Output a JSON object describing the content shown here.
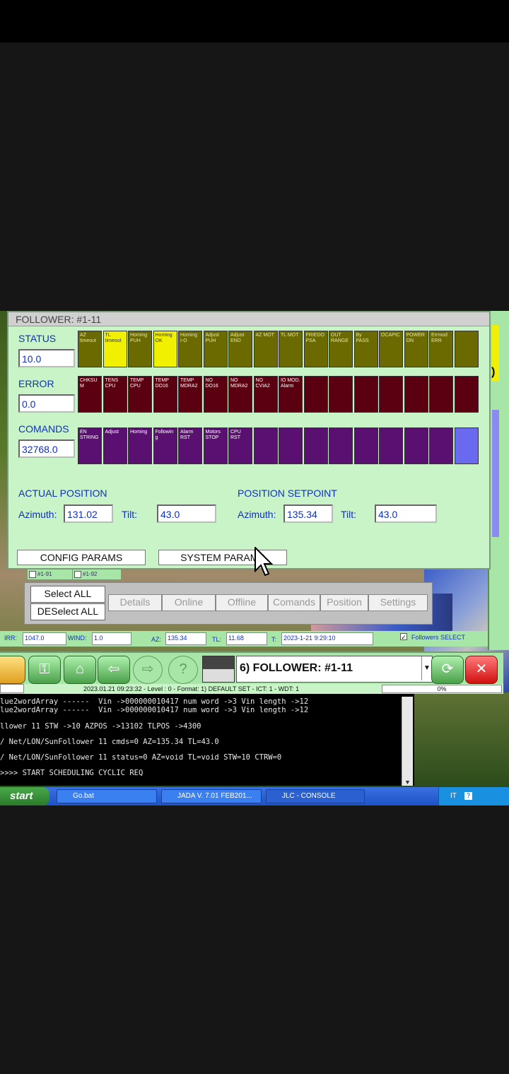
{
  "window_title": "FOLLOWER: #1-11",
  "sections": {
    "status": {
      "label": "STATUS",
      "value": "10.0"
    },
    "error": {
      "label": "ERROR",
      "value": "0.0"
    },
    "comands": {
      "label": "COMANDS",
      "value": "32768.0"
    }
  },
  "status_cells": [
    {
      "text": "AZ timeout",
      "color": "olive"
    },
    {
      "text": "TL timeout",
      "color": "yellow"
    },
    {
      "text": "Homing PUH",
      "color": "olive"
    },
    {
      "text": "Homing OK",
      "color": "yellow"
    },
    {
      "text": "Homing I-O",
      "color": "olive"
    },
    {
      "text": "Adjust PUH",
      "color": "olive"
    },
    {
      "text": "Adjust END",
      "color": "olive"
    },
    {
      "text": "AZ MOT",
      "color": "olive"
    },
    {
      "text": "TL MOT",
      "color": "olive"
    },
    {
      "text": "FRIEDO PSA",
      "color": "olive"
    },
    {
      "text": "OUT RANGE",
      "color": "olive"
    },
    {
      "text": "By PASS",
      "color": "olive"
    },
    {
      "text": "OCAPIC",
      "color": "olive"
    },
    {
      "text": "POWER ON",
      "color": "olive"
    },
    {
      "text": "Errmod ERR",
      "color": "olive"
    },
    {
      "text": "",
      "color": "olive"
    }
  ],
  "error_cells": [
    {
      "text": "CHKSU M"
    },
    {
      "text": "TENS CPU"
    },
    {
      "text": "TEMP CPU"
    },
    {
      "text": "TEMP DO16"
    },
    {
      "text": "TEMP MDRA2"
    },
    {
      "text": "NO DO16"
    },
    {
      "text": "NO MDRA2"
    },
    {
      "text": "NO CVIA2"
    },
    {
      "text": "IO MOD. Alarm"
    },
    {
      "text": ""
    },
    {
      "text": ""
    },
    {
      "text": ""
    },
    {
      "text": ""
    },
    {
      "text": ""
    },
    {
      "text": ""
    },
    {
      "text": ""
    }
  ],
  "comand_cells": [
    {
      "text": "EN STRING"
    },
    {
      "text": "Adjust"
    },
    {
      "text": "Homing"
    },
    {
      "text": "Followin g"
    },
    {
      "text": "Alarm RST"
    },
    {
      "text": "Motors STOP"
    },
    {
      "text": "CPU RST"
    },
    {
      "text": ""
    },
    {
      "text": ""
    },
    {
      "text": ""
    },
    {
      "text": ""
    },
    {
      "text": ""
    },
    {
      "text": ""
    },
    {
      "text": ""
    },
    {
      "text": ""
    },
    {
      "text": ""
    }
  ],
  "actual_position": {
    "title": "ACTUAL POSITION",
    "az_label": "Azimuth:",
    "az": "131.02",
    "tilt_label": "Tilt:",
    "tilt": "43.0"
  },
  "setpoint": {
    "title": "POSITION SETPOINT",
    "az_label": "Azimuth:",
    "az": "135.34",
    "tilt_label": "Tilt:",
    "tilt": "43.0"
  },
  "buttons": {
    "config": "CONFIG PARAMS",
    "system": "SYSTEM PARAMS"
  },
  "tabs": [
    "#1-91",
    "#1-92"
  ],
  "select": {
    "all": "Select ALL",
    "none": "DESelect ALL"
  },
  "actions": [
    "Details",
    "Online",
    "Offline",
    "Comands",
    "Position",
    "Settings"
  ],
  "infobar": {
    "irr_label": "IRR:",
    "irr": "1047.0",
    "wind_label": "WIND:",
    "wind": "1.0",
    "az_label": "AZ:",
    "az": "135.34",
    "tl_label": "TL:",
    "tl": "11.68",
    "t_label": "T:",
    "t": "2023-1-21 9:29:10",
    "followers_select": "Followers SELECT"
  },
  "toolbar": {
    "combo": "6) FOLLOWER: #1-11"
  },
  "statusbar": {
    "text": "2023.01.21   09:23:32 - Level : 0 - Format: 1) DEFAULT SET - ICT: 1 - WDT: 1",
    "progress": "0%"
  },
  "console_lines": [
    "lue2wordArray ------  Vin ->000000010417 num word ->3 Vin length ->12",
    "lue2wordArray ------  Vin ->000000010417 num word ->3 Vin length ->12",
    "llower 11 STW ->10 AZPOS ->13102 TLPOS ->4300",
    "/ Net/LON/SunFollower 11 cmds=0 AZ=135.34 TL=43.0",
    "/ Net/LON/SunFollower 11 status=0 AZ=void TL=void STW=10 CTRW=0",
    ">>>> START SCHEDULING CYCLIC REQ"
  ],
  "taskbar": {
    "start": "start",
    "items": [
      "Go.bat",
      "JADA V. 7.01 FEB201...",
      "JLC - CONSOLE"
    ],
    "lang": "IT"
  }
}
